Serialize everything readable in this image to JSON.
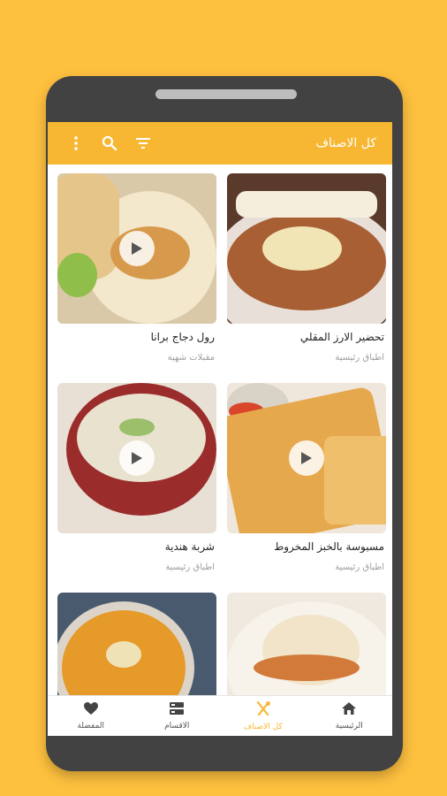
{
  "appbar": {
    "title": "كل الاصناف",
    "icons": [
      "more-vert-icon",
      "search-icon",
      "filter-icon"
    ]
  },
  "recipes": [
    {
      "name": "تحضير الارز المقلي",
      "category": "اطباق رئيسية",
      "has_video": true,
      "colors": [
        "#b86a3c",
        "#e8d8a8",
        "#6e3d1e"
      ]
    },
    {
      "name": "رول دجاج برانا",
      "category": "مقبلات شهية",
      "has_video": true,
      "colors": [
        "#e8c28a",
        "#f4e6c6",
        "#8fbf4a"
      ]
    },
    {
      "name": "مسبوسة بالخبز المخروط",
      "category": "اطباق رئيسية",
      "has_video": true,
      "colors": [
        "#e8a84a",
        "#f3c270",
        "#b66a2a"
      ]
    },
    {
      "name": "شربة هندية",
      "category": "اطباق رئيسية",
      "has_video": true,
      "colors": [
        "#9b2c2c",
        "#e9e2cf",
        "#9bbf6b"
      ]
    },
    {
      "name": "",
      "category": "",
      "has_video": false,
      "colors": [
        "#e8b070",
        "#f4ead8",
        "#d27a3a"
      ]
    },
    {
      "name": "",
      "category": "",
      "has_video": false,
      "colors": [
        "#e59a2a",
        "#d8d0c4",
        "#c8711a"
      ]
    }
  ],
  "bottom_nav": [
    {
      "label": "الرئيسية",
      "icon": "home-icon",
      "active": false
    },
    {
      "label": "كل الاصناف",
      "icon": "cutlery-icon",
      "active": true
    },
    {
      "label": "الاقسام",
      "icon": "categories-icon",
      "active": false
    },
    {
      "label": "المفضلة",
      "icon": "heart-icon",
      "active": false
    }
  ],
  "colors": {
    "background": "#FEC03F",
    "accent": "#F7B733",
    "phone_frame": "#424242"
  }
}
